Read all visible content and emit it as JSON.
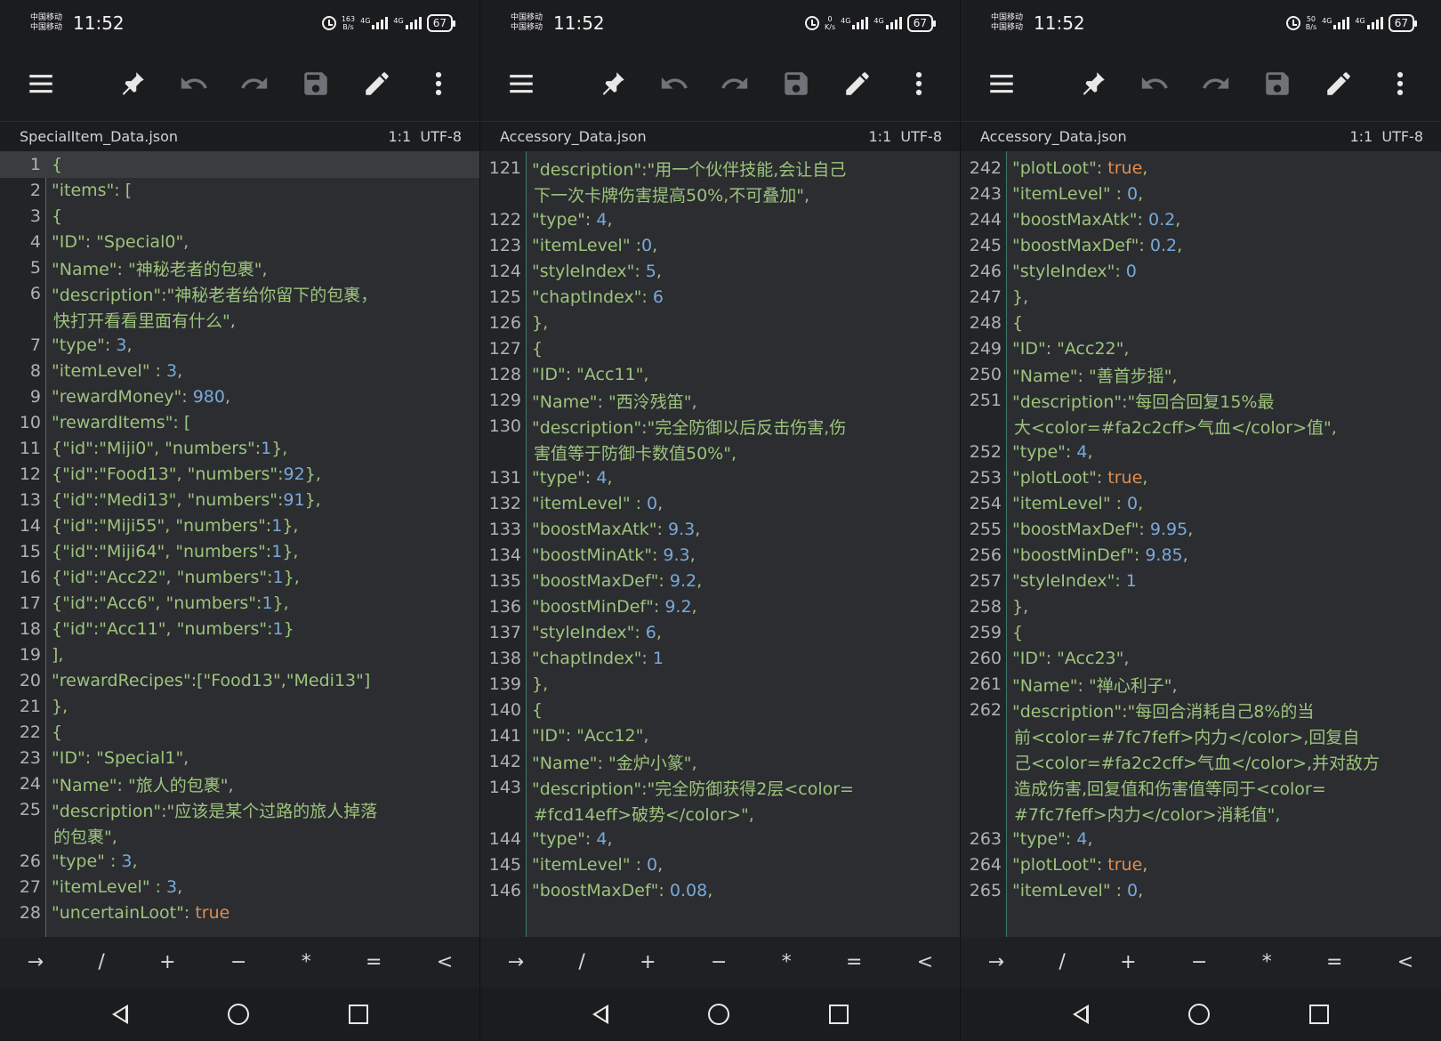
{
  "status": {
    "carrier_line1": "中国移动",
    "carrier_line2": "中国移动",
    "time": "11:52",
    "battery": "67",
    "net_4g": "4G",
    "net_speed": [
      [
        "163",
        "B/s"
      ],
      [
        "0",
        "K/s"
      ],
      [
        "50",
        "B/s"
      ]
    ]
  },
  "toolbar_icons": [
    "menu-icon",
    "pin-icon",
    "undo-icon",
    "redo-icon",
    "save-icon",
    "edit-icon",
    "more-vert-icon"
  ],
  "keys": [
    "→",
    "/",
    "+",
    "−",
    "*",
    "=",
    "<"
  ],
  "screens": [
    {
      "file_name": "SpecialItem_Data.json",
      "cursor_pos": "1:1",
      "encoding": "UTF-8",
      "lines": [
        {
          "n": "1",
          "t": "{"
        },
        {
          "n": "2",
          "t": "  \"items\": ["
        },
        {
          "n": "3",
          "t": "    {"
        },
        {
          "n": "4",
          "t": "      \"ID\": \"Special0\","
        },
        {
          "n": "5",
          "t": "      \"Name\": \"神秘老者的包裹\","
        },
        {
          "n": "6",
          "t": "      \"description\":\"神秘老者给你留下的包裹，"
        },
        {
          "n": "",
          "t": "快打开看看里面有什么\","
        },
        {
          "n": "7",
          "t": "      \"type\": 3,"
        },
        {
          "n": "8",
          "t": "      \"itemLevel\" : 3,"
        },
        {
          "n": "9",
          "t": "      \"rewardMoney\": 980,"
        },
        {
          "n": "10",
          "t": "      \"rewardItems\": ["
        },
        {
          "n": "11",
          "t": "        {\"id\":\"Miji0\", \"numbers\":1},"
        },
        {
          "n": "12",
          "t": "        {\"id\":\"Food13\", \"numbers\":92},"
        },
        {
          "n": "13",
          "t": "        {\"id\":\"Medi13\", \"numbers\":91},"
        },
        {
          "n": "14",
          "t": "        {\"id\":\"Miji55\", \"numbers\":1},"
        },
        {
          "n": "15",
          "t": "        {\"id\":\"Miji64\", \"numbers\":1},"
        },
        {
          "n": "16",
          "t": "        {\"id\":\"Acc22\", \"numbers\":1},"
        },
        {
          "n": "17",
          "t": "        {\"id\":\"Acc6\", \"numbers\":1},"
        },
        {
          "n": "18",
          "t": "        {\"id\":\"Acc11\", \"numbers\":1}"
        },
        {
          "n": "19",
          "t": "      ],"
        },
        {
          "n": "20",
          "t": "      \"rewardRecipes\":[\"Food13\",\"Medi13\"]"
        },
        {
          "n": "21",
          "t": "    },"
        },
        {
          "n": "22",
          "t": "    {"
        },
        {
          "n": "23",
          "t": "      \"ID\": \"Special1\","
        },
        {
          "n": "24",
          "t": "      \"Name\": \"旅人的包裹\","
        },
        {
          "n": "25",
          "t": "      \"description\":\"应该是某个过路的旅人掉落"
        },
        {
          "n": "",
          "t": "的包裹\","
        },
        {
          "n": "26",
          "t": "      \"type\" : 3,"
        },
        {
          "n": "27",
          "t": "      \"itemLevel\" : 3,"
        },
        {
          "n": "28",
          "t": "      \"uncertainLoot\": true"
        }
      ]
    },
    {
      "file_name": "Accessory_Data.json",
      "cursor_pos": "1:1",
      "encoding": "UTF-8",
      "lines": [
        {
          "n": "121",
          "t": "      \"description\":\"用一个伙伴技能,会让自己"
        },
        {
          "n": "",
          "t": "下一次卡牌伤害提高50%,不可叠加\","
        },
        {
          "n": "122",
          "t": "      \"type\": 4,"
        },
        {
          "n": "123",
          "t": "      \"itemLevel\" :0,"
        },
        {
          "n": "124",
          "t": "      \"styleIndex\": 5,"
        },
        {
          "n": "125",
          "t": "      \"chaptIndex\": 6"
        },
        {
          "n": "126",
          "t": "    },"
        },
        {
          "n": "127",
          "t": "    {"
        },
        {
          "n": "128",
          "t": "      \"ID\": \"Acc11\","
        },
        {
          "n": "129",
          "t": "      \"Name\": \"西泠残笛\","
        },
        {
          "n": "130",
          "t": "      \"description\":\"完全防御以后反击伤害,伤"
        },
        {
          "n": "",
          "t": "害值等于防御卡数值50%\","
        },
        {
          "n": "131",
          "t": "      \"type\": 4,"
        },
        {
          "n": "132",
          "t": "      \"itemLevel\" : 0,"
        },
        {
          "n": "133",
          "t": "      \"boostMaxAtk\": 9.3,"
        },
        {
          "n": "134",
          "t": "      \"boostMinAtk\": 9.3,"
        },
        {
          "n": "135",
          "t": "      \"boostMaxDef\": 9.2,"
        },
        {
          "n": "136",
          "t": "      \"boostMinDef\": 9.2,"
        },
        {
          "n": "137",
          "t": "      \"styleIndex\": 6,"
        },
        {
          "n": "138",
          "t": "      \"chaptIndex\": 1"
        },
        {
          "n": "139",
          "t": "    },"
        },
        {
          "n": "140",
          "t": "    {"
        },
        {
          "n": "141",
          "t": "      \"ID\": \"Acc12\","
        },
        {
          "n": "142",
          "t": "      \"Name\": \"金炉小篆\","
        },
        {
          "n": "143",
          "t": "      \"description\":\"完全防御获得2层<color="
        },
        {
          "n": "",
          "t": "#fcd14eff>破势</color>\","
        },
        {
          "n": "144",
          "t": "      \"type\": 4,"
        },
        {
          "n": "145",
          "t": "      \"itemLevel\" : 0,"
        },
        {
          "n": "146",
          "t": "      \"boostMaxDef\": 0.08,"
        }
      ]
    },
    {
      "file_name": "Accessory_Data.json",
      "cursor_pos": "1:1",
      "encoding": "UTF-8",
      "lines": [
        {
          "n": "242",
          "t": "      \"plotLoot\": true,"
        },
        {
          "n": "243",
          "t": "      \"itemLevel\" : 0,"
        },
        {
          "n": "244",
          "t": "      \"boostMaxAtk\": 0.2,"
        },
        {
          "n": "245",
          "t": "      \"boostMaxDef\": 0.2,"
        },
        {
          "n": "246",
          "t": "      \"styleIndex\": 0"
        },
        {
          "n": "247",
          "t": "    },"
        },
        {
          "n": "248",
          "t": "    {"
        },
        {
          "n": "249",
          "t": "      \"ID\": \"Acc22\","
        },
        {
          "n": "250",
          "t": "      \"Name\": \"善首步摇\","
        },
        {
          "n": "251",
          "t": "      \"description\":\"每回合回复15%最"
        },
        {
          "n": "",
          "t": "大<color=#fa2c2cff>气血</color>值\","
        },
        {
          "n": "252",
          "t": "      \"type\": 4,"
        },
        {
          "n": "253",
          "t": "      \"plotLoot\": true,"
        },
        {
          "n": "254",
          "t": "      \"itemLevel\" : 0,"
        },
        {
          "n": "255",
          "t": "      \"boostMaxDef\": 9.95,"
        },
        {
          "n": "256",
          "t": "      \"boostMinDef\": 9.85,"
        },
        {
          "n": "257",
          "t": "      \"styleIndex\": 1"
        },
        {
          "n": "258",
          "t": "    },"
        },
        {
          "n": "259",
          "t": "    {"
        },
        {
          "n": "260",
          "t": "      \"ID\": \"Acc23\","
        },
        {
          "n": "261",
          "t": "      \"Name\": \"禅心利子\","
        },
        {
          "n": "262",
          "t": "      \"description\":\"每回合消耗自己8%的当"
        },
        {
          "n": "",
          "t": "前<color=#7fc7feff>内力</color>,回复自"
        },
        {
          "n": "",
          "t": "己<color=#fa2c2cff>气血</color>,并对敌方"
        },
        {
          "n": "",
          "t": "造成伤害,回复值和伤害值等同于<color="
        },
        {
          "n": "",
          "t": "#7fc7feff>内力</color>消耗值\","
        },
        {
          "n": "263",
          "t": "      \"type\": 4,"
        },
        {
          "n": "264",
          "t": "      \"plotLoot\": true,"
        },
        {
          "n": "265",
          "t": "      \"itemLevel\" : 0,"
        }
      ]
    }
  ],
  "colors": {
    "string": "#9dc37c",
    "number": "#79a9d9",
    "boolean": "#e08d4f",
    "gutter_border": "#3e7b64"
  }
}
